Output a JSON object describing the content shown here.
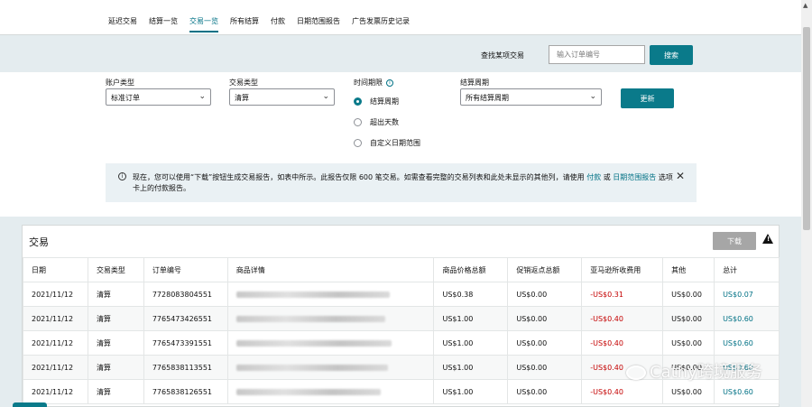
{
  "nav": {
    "tabs": [
      {
        "label": "延迟交易"
      },
      {
        "label": "结算一览"
      },
      {
        "label": "交易一览"
      },
      {
        "label": "所有结算"
      },
      {
        "label": "付款"
      },
      {
        "label": "日期范围报告"
      },
      {
        "label": "广告发票历史记录"
      }
    ],
    "active_index": 2
  },
  "search": {
    "label": "查找某项交易",
    "placeholder": "输入订单编号",
    "button": "搜索"
  },
  "filters": {
    "account_type_label": "账户类型",
    "account_type_value": "标准订单",
    "transaction_type_label": "交易类型",
    "transaction_type_value": "清算",
    "time_range_label": "时间期限",
    "time_options": [
      "结算周期",
      "超出天数",
      "自定义日期范围"
    ],
    "time_selected": 0,
    "settlement_label": "结算周期",
    "settlement_value": "所有结算周期",
    "refresh_button": "更新"
  },
  "banner": {
    "text_pre": "现在，您可以使用“下载”按钮生成交易报告，如表中所示。此报告仅限 600 笔交易。如需查看完整的交易列表和此处未显示的其他列，请使用",
    "link1": "付款",
    "text_mid": "或",
    "link2": "日期范围报告",
    "text_post": "选项卡上的付款报告。"
  },
  "transactions": {
    "title": "交易",
    "download_button": "下载",
    "columns": [
      "日期",
      "交易类型",
      "订单编号",
      "商品详情",
      "商品价格总额",
      "促销返点总额",
      "亚马逊所收费用",
      "其他",
      "总计"
    ],
    "rows": [
      {
        "date": "2021/11/12",
        "type": "清算",
        "order": "7728083804551",
        "product": "",
        "price": "US$0.38",
        "promo": "US$0.00",
        "fees": "-US$0.31",
        "other": "US$0.00",
        "total": "US$0.07"
      },
      {
        "date": "2021/11/12",
        "type": "清算",
        "order": "7765473426551",
        "product": "",
        "price": "US$1.00",
        "promo": "US$0.00",
        "fees": "-US$0.40",
        "other": "US$0.00",
        "total": "US$0.60"
      },
      {
        "date": "2021/11/12",
        "type": "清算",
        "order": "7765473391551",
        "product": "",
        "price": "US$1.00",
        "promo": "US$0.00",
        "fees": "-US$0.40",
        "other": "US$0.00",
        "total": "US$0.60"
      },
      {
        "date": "2021/11/12",
        "type": "清算",
        "order": "7765838113551",
        "product": "",
        "price": "US$1.00",
        "promo": "US$0.00",
        "fees": "-US$0.40",
        "other": "US$0.00",
        "total": "US$0.60"
      },
      {
        "date": "2021/11/12",
        "type": "清算",
        "order": "7765838126551",
        "product": "",
        "price": "US$1.00",
        "promo": "US$0.00",
        "fees": "-US$0.40",
        "other": "US$0.00",
        "total": "US$0.60"
      }
    ]
  },
  "watermark": "Cathy跨境服务"
}
